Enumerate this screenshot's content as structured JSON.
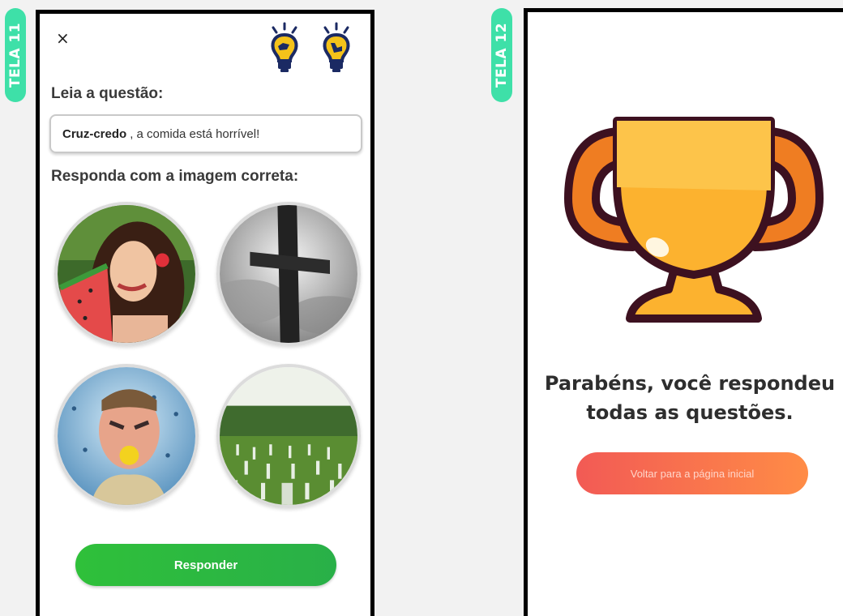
{
  "colors": {
    "tag_bg": "#3ee0a8",
    "answer_button_from": "#2fc03a",
    "answer_button_to": "#29b048",
    "home_button_from": "#f25a55",
    "home_button_to": "#ff8c46",
    "trophy_orange": "#ef7d22",
    "trophy_gold": "#fcb22f",
    "trophy_outline": "#3d1120"
  },
  "screen_11": {
    "tag": "TELA 11",
    "close_icon": "×",
    "hint_icons": [
      "lightbulb-icon",
      "lightbulb-icon"
    ],
    "read_label": "Leia a questão:",
    "question_highlight": "Cruz-credo",
    "question_rest": ", a comida está horrível!",
    "answer_label": "Responda com a imagem correta:",
    "options": [
      {
        "name": "woman-eating-watermelon"
      },
      {
        "name": "stone-cross"
      },
      {
        "name": "man-biting-lemon"
      },
      {
        "name": "cemetery-field"
      }
    ],
    "submit_label": "Responder"
  },
  "screen_12": {
    "tag": "TELA 12",
    "trophy_icon": "trophy-icon",
    "congrats_line1": "Parabéns, você respondeu",
    "congrats_line2": "todas as questões.",
    "home_button": "Voltar para a página inicial"
  }
}
